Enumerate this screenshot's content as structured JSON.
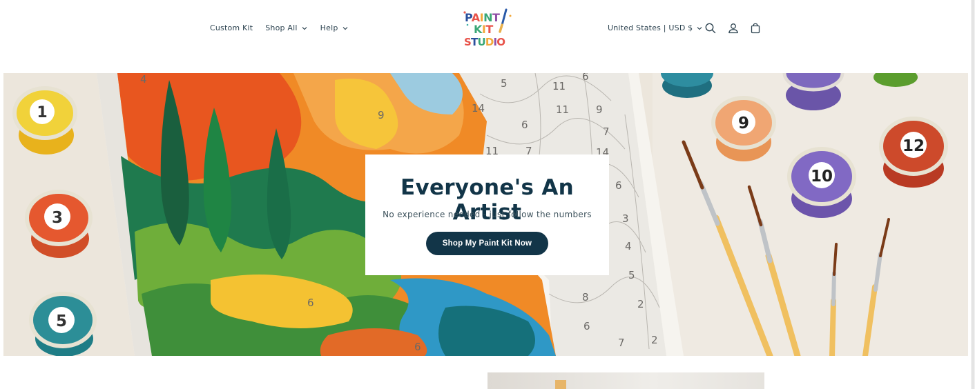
{
  "header": {
    "nav": [
      {
        "label": "Custom Kit",
        "has_dropdown": false
      },
      {
        "label": "Shop All",
        "has_dropdown": true
      },
      {
        "label": "Help",
        "has_dropdown": true
      }
    ],
    "logo": {
      "line1": "PAINT",
      "line2": "KIT",
      "line3": "STUDIO"
    },
    "locale": "United States | USD $",
    "icons": [
      "search-icon",
      "account-icon",
      "cart-icon"
    ]
  },
  "hero": {
    "title": "Everyone's An Artist",
    "subtitle": "No experience needed - just follow the numbers",
    "cta_label": "Shop My Paint Kit Now",
    "pots": [
      "1",
      "3",
      "5",
      "9",
      "10",
      "12"
    ],
    "canvas_numbers": [
      "4",
      "5",
      "11",
      "6",
      "14",
      "6",
      "11",
      "9",
      "9",
      "7",
      "11",
      "7",
      "14",
      "6",
      "3",
      "4",
      "5",
      "8",
      "2",
      "6",
      "6",
      "6",
      "7",
      "2"
    ]
  },
  "colors": {
    "primary": "#123548",
    "text": "#2d4350",
    "card_bg": "#ffffff"
  }
}
